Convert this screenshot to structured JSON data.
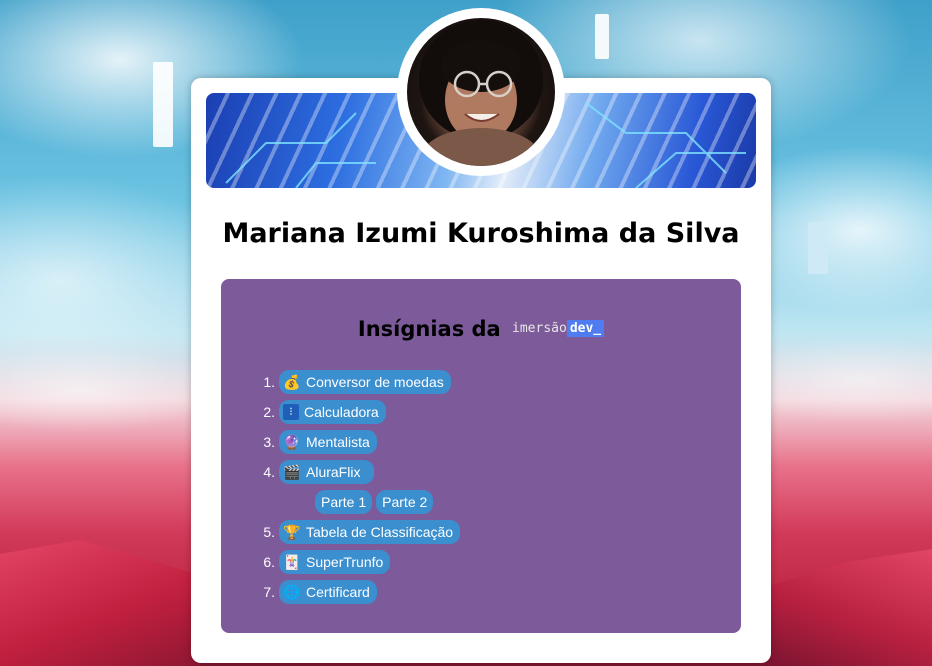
{
  "profile": {
    "name": "Mariana Izumi Kuroshima da Silva"
  },
  "badges": {
    "title": "Insígnias da",
    "brand_prefix": "imersão",
    "brand_suffix": "dev_",
    "items": [
      {
        "number": "1.",
        "icon": "money-bag-icon",
        "label": "Conversor de moedas"
      },
      {
        "number": "2.",
        "icon": "calculator-icon",
        "label": "Calculadora"
      },
      {
        "number": "3.",
        "icon": "crystal-ball-icon",
        "label": "Mentalista"
      },
      {
        "number": "4.",
        "icon": "clapper-board-icon",
        "label": "AluraFlix",
        "parts": [
          "Parte 1",
          "Parte 2"
        ]
      },
      {
        "number": "5.",
        "icon": "trophy-icon",
        "label": "Tabela de Classificação"
      },
      {
        "number": "6.",
        "icon": "playing-card-icon",
        "label": "SuperTrunfo"
      },
      {
        "number": "7.",
        "icon": "globe-icon",
        "label": "Certificard"
      }
    ]
  },
  "colors": {
    "card_background": "#ffffff",
    "badges_panel": "#7d5a99",
    "pill": "#3b8fcf",
    "dev_highlight": "#4f7cf0"
  }
}
